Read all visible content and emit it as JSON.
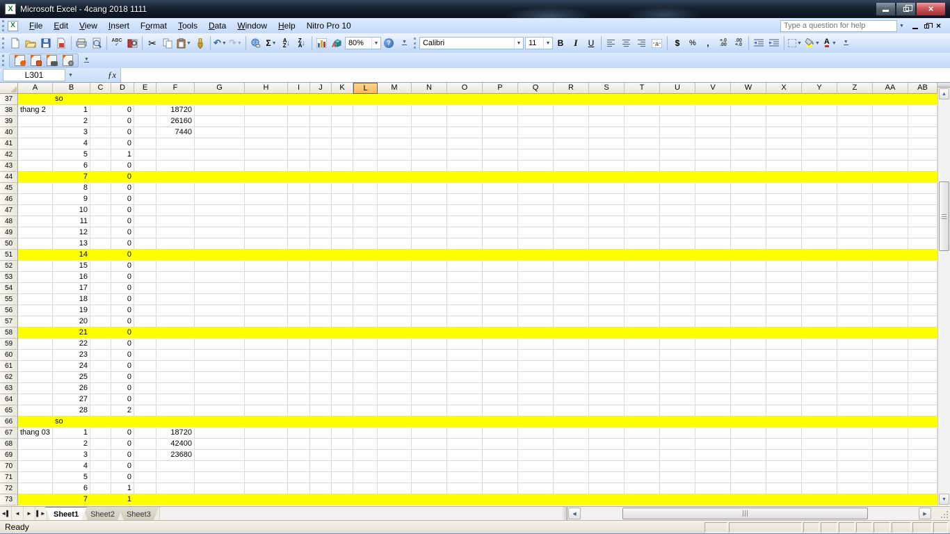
{
  "window": {
    "title": "Microsoft Excel - 4cang 2018 1111",
    "app_icon_letter": "X"
  },
  "menu": {
    "items": [
      {
        "label": "File",
        "key": "F"
      },
      {
        "label": "Edit",
        "key": "E"
      },
      {
        "label": "View",
        "key": "V"
      },
      {
        "label": "Insert",
        "key": "I"
      },
      {
        "label": "Format",
        "key": "o"
      },
      {
        "label": "Tools",
        "key": "T"
      },
      {
        "label": "Data",
        "key": "D"
      },
      {
        "label": "Window",
        "key": "W"
      },
      {
        "label": "Help",
        "key": "H"
      },
      {
        "label": "Nitro Pro 10",
        "key": null
      }
    ],
    "help_box_placeholder": "Type a question for help"
  },
  "standard_toolbar": {
    "spelling_label": "ABC",
    "cut_glyph": "✂",
    "undo_glyph": "↶",
    "redo_glyph": "↷",
    "autosum_glyph": "Σ",
    "sort_asc": {
      "top": "A",
      "bottom": "Z",
      "arrow": "↓"
    },
    "sort_desc": {
      "top": "Z",
      "bottom": "A",
      "arrow": "↓"
    },
    "zoom_value": "80%",
    "help_glyph": "?"
  },
  "formatting_toolbar": {
    "font_name": "Calibri",
    "font_size": "11",
    "bold_label": "B",
    "italic_label": "I",
    "underline_label": "U",
    "currency_label": "$",
    "percent_label": "%",
    "comma_label": ",",
    "increase_decimal": [
      "+.0",
      ".00"
    ],
    "decrease_decimal": [
      ".00",
      "+.0"
    ],
    "font_color_letter": "A",
    "drawing_letter": "A"
  },
  "formula_bar": {
    "name_box": "L301",
    "fx_label": "ƒx"
  },
  "spreadsheet": {
    "selected_column": "L",
    "row_header_width": 26,
    "columns": [
      {
        "letter": "A",
        "width": 50
      },
      {
        "letter": "B",
        "width": 54
      },
      {
        "letter": "C",
        "width": 30
      },
      {
        "letter": "D",
        "width": 33
      },
      {
        "letter": "E",
        "width": 32
      },
      {
        "letter": "F",
        "width": 55
      },
      {
        "letter": "G",
        "width": 72
      },
      {
        "letter": "H",
        "width": 62
      },
      {
        "letter": "I",
        "width": 32
      },
      {
        "letter": "J",
        "width": 31
      },
      {
        "letter": "K",
        "width": 31
      },
      {
        "letter": "L",
        "width": 35
      },
      {
        "letter": "M",
        "width": 49
      },
      {
        "letter": "N",
        "width": 51
      },
      {
        "letter": "O",
        "width": 51
      },
      {
        "letter": "P",
        "width": 51
      },
      {
        "letter": "Q",
        "width": 51
      },
      {
        "letter": "R",
        "width": 51
      },
      {
        "letter": "S",
        "width": 51
      },
      {
        "letter": "T",
        "width": 51
      },
      {
        "letter": "U",
        "width": 51
      },
      {
        "letter": "V",
        "width": 51
      },
      {
        "letter": "W",
        "width": 51
      },
      {
        "letter": "X",
        "width": 51
      },
      {
        "letter": "Y",
        "width": 51
      },
      {
        "letter": "Z",
        "width": 51
      },
      {
        "letter": "AA",
        "width": 51
      },
      {
        "letter": "AB",
        "width": 42
      }
    ],
    "highlight_color": "#FFFF00",
    "selected_header_color": "#FBBE5E",
    "rows": [
      {
        "n": 37,
        "hl": true,
        "cells": {
          "B": "so"
        }
      },
      {
        "n": 38,
        "hl": false,
        "cells": {
          "A": "thang 2",
          "B": 1,
          "D": 0,
          "F": 18720
        }
      },
      {
        "n": 39,
        "hl": false,
        "cells": {
          "B": 2,
          "D": 0,
          "F": 26160
        }
      },
      {
        "n": 40,
        "hl": false,
        "cells": {
          "B": 3,
          "D": 0,
          "F": 7440
        }
      },
      {
        "n": 41,
        "hl": false,
        "cells": {
          "B": 4,
          "D": 0
        }
      },
      {
        "n": 42,
        "hl": false,
        "cells": {
          "B": 5,
          "D": 1
        }
      },
      {
        "n": 43,
        "hl": false,
        "cells": {
          "B": 6,
          "D": 0
        }
      },
      {
        "n": 44,
        "hl": true,
        "cells": {
          "B": 7,
          "D": 0
        }
      },
      {
        "n": 45,
        "hl": false,
        "cells": {
          "B": 8,
          "D": 0
        }
      },
      {
        "n": 46,
        "hl": false,
        "cells": {
          "B": 9,
          "D": 0
        }
      },
      {
        "n": 47,
        "hl": false,
        "cells": {
          "B": 10,
          "D": 0
        }
      },
      {
        "n": 48,
        "hl": false,
        "cells": {
          "B": 11,
          "D": 0
        }
      },
      {
        "n": 49,
        "hl": false,
        "cells": {
          "B": 12,
          "D": 0
        }
      },
      {
        "n": 50,
        "hl": false,
        "cells": {
          "B": 13,
          "D": 0
        }
      },
      {
        "n": 51,
        "hl": true,
        "cells": {
          "B": 14,
          "D": 0
        }
      },
      {
        "n": 52,
        "hl": false,
        "cells": {
          "B": 15,
          "D": 0
        }
      },
      {
        "n": 53,
        "hl": false,
        "cells": {
          "B": 16,
          "D": 0
        }
      },
      {
        "n": 54,
        "hl": false,
        "cells": {
          "B": 17,
          "D": 0
        }
      },
      {
        "n": 55,
        "hl": false,
        "cells": {
          "B": 18,
          "D": 0
        }
      },
      {
        "n": 56,
        "hl": false,
        "cells": {
          "B": 19,
          "D": 0
        }
      },
      {
        "n": 57,
        "hl": false,
        "cells": {
          "B": 20,
          "D": 0
        }
      },
      {
        "n": 58,
        "hl": true,
        "cells": {
          "B": 21,
          "D": 0
        }
      },
      {
        "n": 59,
        "hl": false,
        "cells": {
          "B": 22,
          "D": 0
        }
      },
      {
        "n": 60,
        "hl": false,
        "cells": {
          "B": 23,
          "D": 0
        }
      },
      {
        "n": 61,
        "hl": false,
        "cells": {
          "B": 24,
          "D": 0
        }
      },
      {
        "n": 62,
        "hl": false,
        "cells": {
          "B": 25,
          "D": 0
        }
      },
      {
        "n": 63,
        "hl": false,
        "cells": {
          "B": 26,
          "D": 0
        }
      },
      {
        "n": 64,
        "hl": false,
        "cells": {
          "B": 27,
          "D": 0
        }
      },
      {
        "n": 65,
        "hl": false,
        "cells": {
          "B": 28,
          "D": 2
        }
      },
      {
        "n": 66,
        "hl": true,
        "cells": {
          "B": "so"
        }
      },
      {
        "n": 67,
        "hl": false,
        "cells": {
          "A": "thang 03",
          "B": 1,
          "D": 0,
          "F": 18720
        }
      },
      {
        "n": 68,
        "hl": false,
        "cells": {
          "B": 2,
          "D": 0,
          "F": 42400
        }
      },
      {
        "n": 69,
        "hl": false,
        "cells": {
          "B": 3,
          "D": 0,
          "F": 23680
        }
      },
      {
        "n": 70,
        "hl": false,
        "cells": {
          "B": 4,
          "D": 0
        }
      },
      {
        "n": 71,
        "hl": false,
        "cells": {
          "B": 5,
          "D": 0
        }
      },
      {
        "n": 72,
        "hl": false,
        "cells": {
          "B": 6,
          "D": 1
        }
      },
      {
        "n": 73,
        "hl": true,
        "cells": {
          "B": 7,
          "D": 1
        }
      }
    ]
  },
  "sheet_tabs": {
    "tabs": [
      {
        "label": "Sheet1",
        "active": true
      },
      {
        "label": "Sheet2",
        "active": false
      },
      {
        "label": "Sheet3",
        "active": false
      }
    ]
  },
  "status_bar": {
    "message": "Ready"
  }
}
